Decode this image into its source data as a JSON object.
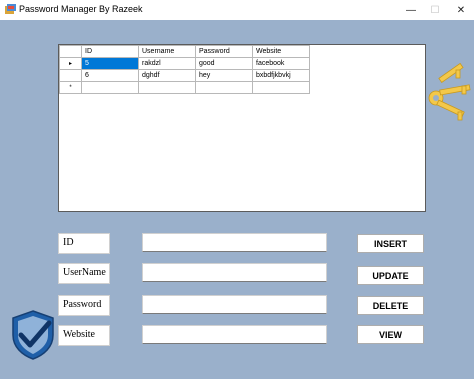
{
  "window": {
    "title": "Password Manager By Razeek",
    "controls": {
      "minimize": "—",
      "maximize": "☐",
      "close": "✕"
    }
  },
  "grid": {
    "columns": [
      "ID",
      "Username",
      "Password",
      "Website"
    ],
    "rows": [
      {
        "indicator": "▸",
        "id": "5",
        "username": "rakdzl",
        "password": "good",
        "website": "facebook"
      },
      {
        "indicator": "",
        "id": "6",
        "username": "dghdf",
        "password": "hey",
        "website": "bxbdfjkbvkj"
      }
    ],
    "new_row_indicator": "*"
  },
  "form": {
    "id_label": "ID",
    "username_label": "UserName",
    "password_label": "Password",
    "website_label": "Website",
    "id_value": "",
    "username_value": "",
    "password_value": "",
    "website_value": ""
  },
  "buttons": {
    "insert": "INSERT",
    "update": "UPDATE",
    "delete": "DELETE",
    "view": "VIEW"
  },
  "icons": {
    "app": "app-icon",
    "keys": "keys-icon",
    "shield": "shield-check-icon"
  },
  "colors": {
    "background": "#9ab0cb",
    "selection": "#0078d7",
    "keys": "#f3c84a",
    "shield": "#1f5fa8"
  }
}
